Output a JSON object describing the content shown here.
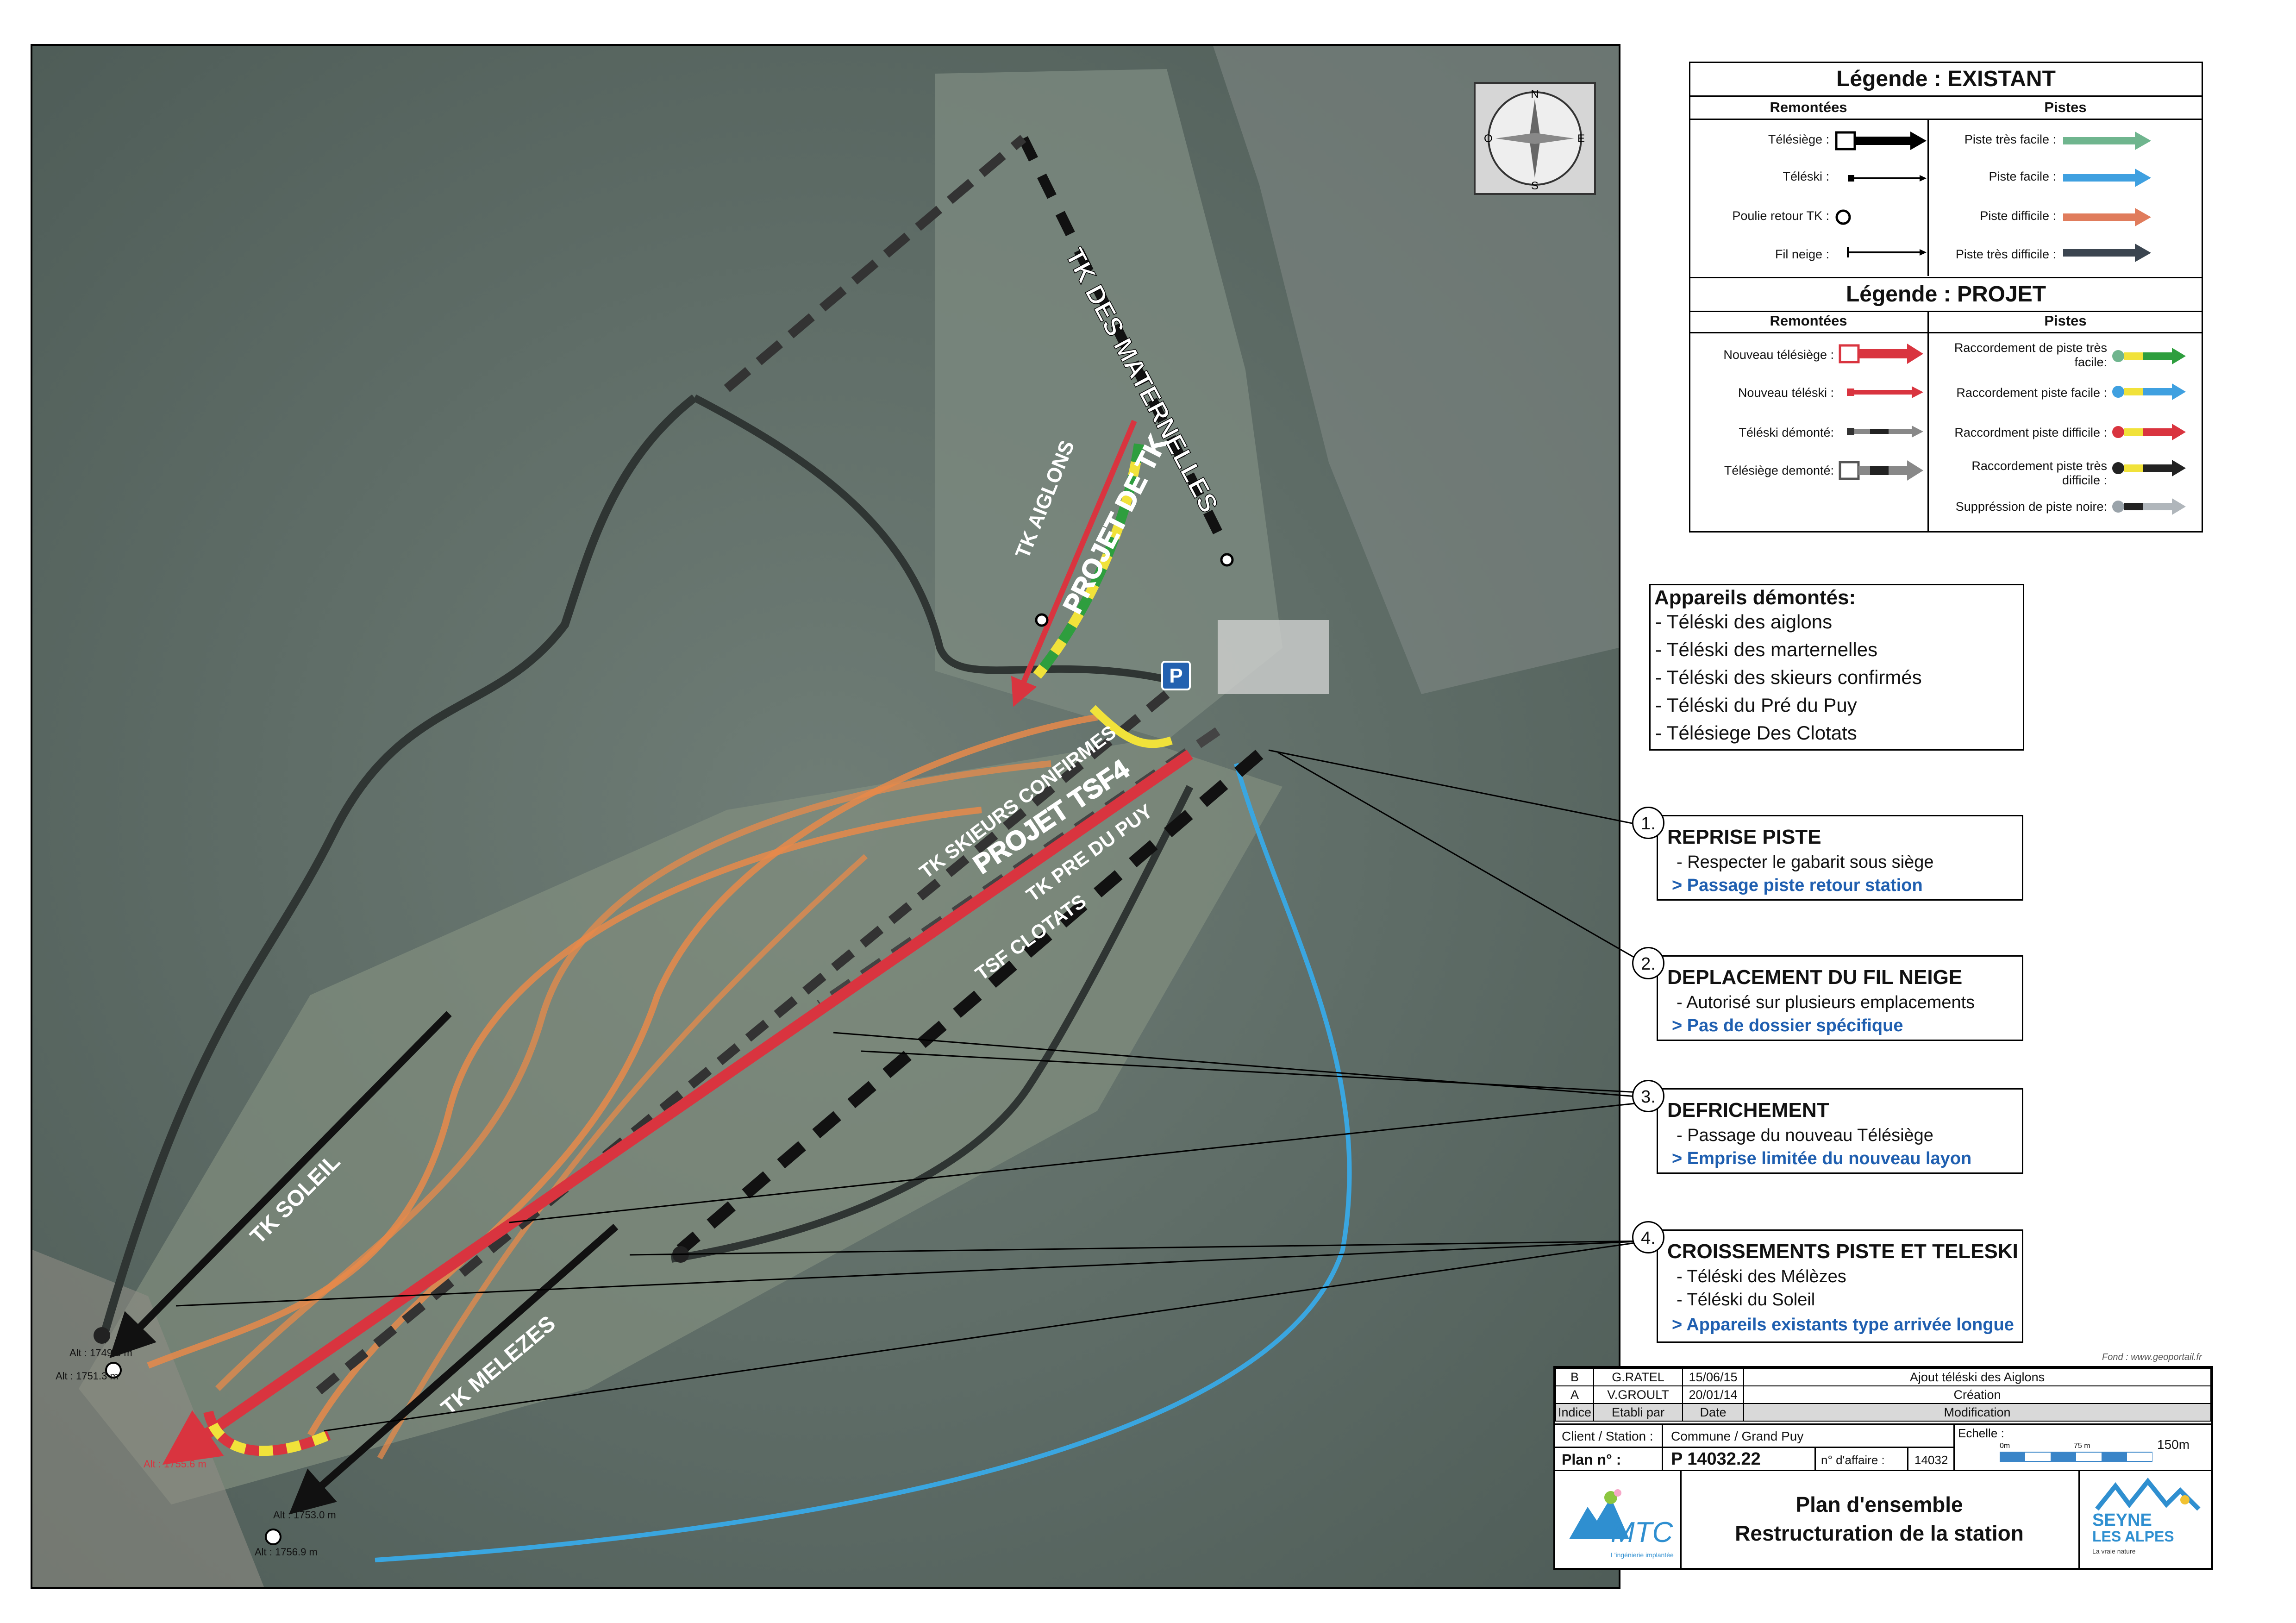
{
  "map": {
    "labels": {
      "tk_maternelles": "TK DES MATERNELLES",
      "tk_aiglons": "TK AIGLONS",
      "projet_tk": "PROJET DE TK",
      "tk_skieurs": "TK SKIEURS CONFIRMES",
      "projet_tsf4": "PROJET TSF4",
      "tk_pre_du_puy": "TK PRE DU PUY",
      "tsf_clotats": "TSF CLOTATS",
      "tk_soleil": "TK SOLEIL",
      "tk_melezes": "TK MELEZES",
      "parking": "P",
      "alt_1": "Alt : 1749.0 m",
      "alt_2": "Alt : 1751.3 m",
      "alt_3": "Alt : 1755.6 m",
      "alt_4": "Alt : 1753.0 m",
      "alt_5": "Alt : 1756.9 m"
    },
    "compass": {
      "n": "N",
      "s": "S",
      "e": "E",
      "o": "O"
    }
  },
  "legend_existant": {
    "title": "Légende : EXISTANT",
    "col_remontees": "Remontées",
    "col_pistes": "Pistes",
    "remontees": [
      "Télésiège :",
      "Téléski :",
      "Poulie retour TK :",
      "Fil neige :"
    ],
    "pistes": [
      "Piste très facile :",
      "Piste facile :",
      "Piste difficile :",
      "Piste très difficile :"
    ]
  },
  "legend_projet": {
    "title": "Légende : PROJET",
    "col_remontees": "Remontées",
    "col_pistes": "Pistes",
    "remontees": [
      "Nouveau télésiège :",
      "Nouveau téléski :",
      "Téléski démonté:",
      "Télésiège demonté:"
    ],
    "pistes": [
      "Raccordement de piste très facile:",
      "Raccordement piste facile :",
      "Raccordment piste difficile :",
      "Raccordement piste très difficile :",
      "Suppréssion de piste noire:"
    ]
  },
  "colors": {
    "tres_facile": "#6fb58e",
    "facile": "#3fa0e0",
    "difficile": "#e07c5c",
    "tres_difficile": "#3b4550",
    "projet_red": "#d9343f",
    "cable_orange": "#e8894a",
    "piste_blue": "#3aa6e0"
  },
  "appareils": {
    "title": "Appareils démontés:",
    "items": [
      "- Téléski des aiglons",
      "- Téléski des marternelles",
      "- Téléski des skieurs confirmés",
      "- Téléski du Pré du Puy",
      "- Télésiege Des Clotats"
    ]
  },
  "notes": [
    {
      "num": "1.",
      "title": "REPRISE PISTE",
      "line": "- Respecter le gabarit sous siège",
      "blue": "> Passage piste retour station"
    },
    {
      "num": "2.",
      "title": "DEPLACEMENT DU FIL NEIGE",
      "line": "- Autorisé sur plusieurs emplacements",
      "blue": "> Pas de  dossier spécifique"
    },
    {
      "num": "3.",
      "title": "DEFRICHEMENT",
      "line": "- Passage du nouveau Télésiège",
      "blue": "> Emprise limitée du nouveau layon"
    },
    {
      "num": "4.",
      "title": "CROISSEMENTS  PISTE ET TELESKI",
      "line": "- Téléski des Mélèzes",
      "line2": "- Téléski du Soleil",
      "blue": "> Appareils existants type arrivée longue"
    }
  ],
  "fond": "Fond : www.geoportail.fr",
  "cartouche": {
    "rows": [
      {
        "indice": "B",
        "par": "G.RATEL",
        "date": "15/06/15",
        "modif": "Ajout téléski des Aiglons"
      },
      {
        "indice": "A",
        "par": "V.GROULT",
        "date": "20/01/14",
        "modif": "Création"
      }
    ],
    "headers": {
      "indice": "Indice",
      "par": "Etabli par",
      "date": "Date",
      "modif": "Modification"
    },
    "client_label": "Client / Station :",
    "client_value": "Commune / Grand Puy",
    "plan_label": "Plan n° :",
    "plan_value": "P 14032.22",
    "affaire_label": "n° d'affaire :",
    "affaire_value": "14032",
    "echelle_label": "Echelle :",
    "scale_0": "0m",
    "scale_75": "75 m",
    "scale_150": "150m",
    "title_1": "Plan d'ensemble",
    "title_2": "Restructuration de la station",
    "logo_mtc": "MTC",
    "logo_mtc_sub": "L'ingénierie implantée",
    "logo_seyne_1": "SEYNE",
    "logo_seyne_2": "LES ALPES",
    "logo_seyne_sub": "La vraie nature"
  }
}
